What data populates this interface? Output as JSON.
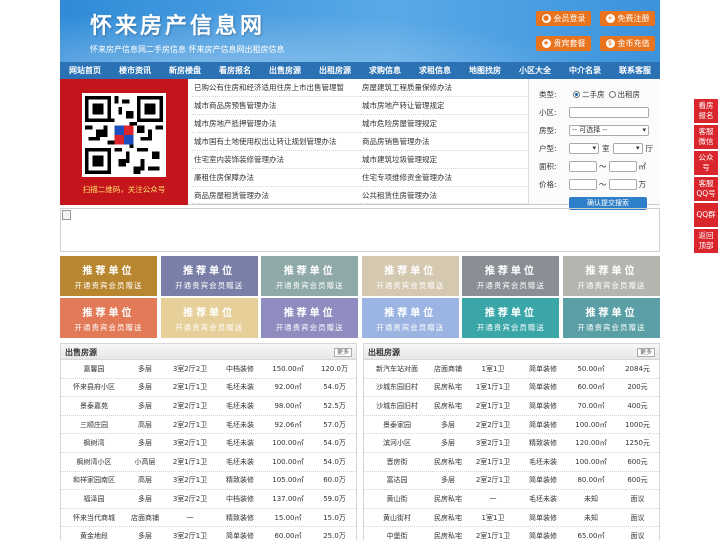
{
  "header": {
    "site_title": "怀来房产信息网",
    "slogan": "怀来房产信息网二手房信息 怀来房产信息网出租房信息",
    "buttons": [
      {
        "label": "会员登录",
        "icon": "user-icon"
      },
      {
        "label": "免费注册",
        "icon": "register-icon"
      },
      {
        "label": "贵宾套餐",
        "icon": "vip-icon"
      },
      {
        "label": "金币充值",
        "icon": "coin-icon"
      }
    ]
  },
  "nav": [
    "网站首页",
    "楼市资讯",
    "新房楼盘",
    "看房报名",
    "出售房源",
    "出租房源",
    "求购信息",
    "求租信息",
    "地图找房",
    "小区大全",
    "中介名录",
    "联系客服"
  ],
  "qr": {
    "caption": "扫描二维码，关注公众号"
  },
  "links": [
    "已购公有住房和经济适用住房上市出售管理暂",
    "房屋建筑工程质量保修办法",
    "城市商品房预售管理办法",
    "城市房地产转让管理规定",
    "城市房地产抵押管理办法",
    "城市危险房屋管理规定",
    "城市国有土地使用权出让转让规划管理办法",
    "商品房销售管理办法",
    "住宅室内装饰装修管理办法",
    "城市建筑垃圾管理规定",
    "廉租住房保障办法",
    "住宅专项维修资金管理办法",
    "商品房屋租赁管理办法",
    "公共租赁住房管理办法"
  ],
  "search": {
    "type_label": "类型:",
    "type_options": [
      "二手房",
      "出租房"
    ],
    "type_selected": "二手房",
    "community_label": "小区:",
    "house_type_label": "房型:",
    "house_type_value": "-- 可选择 --",
    "unit_label": "户型:",
    "unit_room": "室",
    "unit_hall": "厅",
    "area_label": "面积:",
    "area_sep": "～",
    "area_unit": "㎡",
    "price_label": "价格:",
    "price_sep": "～",
    "price_unit": "万",
    "submit_label": "确认提交搜索"
  },
  "tiles": {
    "title": "推荐单位",
    "subtitle": "开通贵宾会员赠送",
    "colors": [
      "#b8862f",
      "#7a7fa8",
      "#8fa8a8",
      "#d4c8b0",
      "#8a8f96",
      "#b5b5b0",
      "#e27a58",
      "#e6cf98",
      "#8f8cc0",
      "#9cb4e2",
      "#3aa6a8",
      "#5a9fa6"
    ]
  },
  "sale": {
    "title": "出售房源",
    "more": "更多",
    "rows": [
      [
        "嘉馨园",
        "多层",
        "3室2厅2卫",
        "中档装修",
        "150.00㎡",
        "120.0万"
      ],
      [
        "怀来县府小区",
        "多层",
        "2室1厅1卫",
        "毛坯未装",
        "92.00㎡",
        "54.0万"
      ],
      [
        "景泰嘉苑",
        "多层",
        "2室2厅1卫",
        "毛坯未装",
        "98.00㎡",
        "52.5万"
      ],
      [
        "三顺庄园",
        "高层",
        "2室2厅1卫",
        "毛坯未装",
        "92.06㎡",
        "57.0万"
      ],
      [
        "枫树湾",
        "多层",
        "3室2厅1卫",
        "毛坯未装",
        "100.00㎡",
        "54.0万"
      ],
      [
        "枫树湾小区",
        "小高层",
        "2室1厅1卫",
        "毛坯未装",
        "100.00㎡",
        "54.0万"
      ],
      [
        "和祥家园南区",
        "高层",
        "3室2厅1卫",
        "精致装修",
        "105.00㎡",
        "60.0万"
      ],
      [
        "福泽园",
        "多层",
        "3室2厅2卫",
        "中档装修",
        "137.00㎡",
        "59.0万"
      ],
      [
        "怀来当代商城",
        "店面商铺",
        "一",
        "精致装修",
        "15.00㎡",
        "15.0万"
      ],
      [
        "黄金地段",
        "多层",
        "3室2厅1卫",
        "简单装修",
        "60.00㎡",
        "25.0万"
      ]
    ]
  },
  "rent": {
    "title": "出租房源",
    "more": "更多",
    "rows": [
      [
        "新汽车站对面",
        "店面商铺",
        "1室1卫",
        "简单装修",
        "50.00㎡",
        "2084元"
      ],
      [
        "沙城东园旧村",
        "民房私宅",
        "1室1厅1卫",
        "简单装修",
        "60.00㎡",
        "200元"
      ],
      [
        "沙城东园旧村",
        "民房私宅",
        "2室1厅1卫",
        "简单装修",
        "70.00㎡",
        "400元"
      ],
      [
        "景泰家园",
        "多层",
        "2室2厅1卫",
        "简单装修",
        "100.00㎡",
        "1000元"
      ],
      [
        "滨河小区",
        "多层",
        "3室2厅1卫",
        "精致装修",
        "120.00㎡",
        "1250元"
      ],
      [
        "晋房街",
        "民房私宅",
        "2室1厅1卫",
        "毛坯未装",
        "100.00㎡",
        "600元"
      ],
      [
        "富达园",
        "多层",
        "2室2厅1卫",
        "简单装修",
        "80.00㎡",
        "600元"
      ],
      [
        "黄山街",
        "民房私宅",
        "一",
        "毛坯未装",
        "未知",
        "面议"
      ],
      [
        "黄山街村",
        "民房私宅",
        "1室1卫",
        "简单装修",
        "未知",
        "面议"
      ],
      [
        "中堡街",
        "民房私宅",
        "2室1厅1卫",
        "简单装修",
        "65.00㎡",
        "面议"
      ]
    ]
  },
  "sidebar": [
    "看房报名",
    "客服微信",
    "公众号",
    "客服QQ号",
    "QQ群",
    "返回顶部"
  ]
}
